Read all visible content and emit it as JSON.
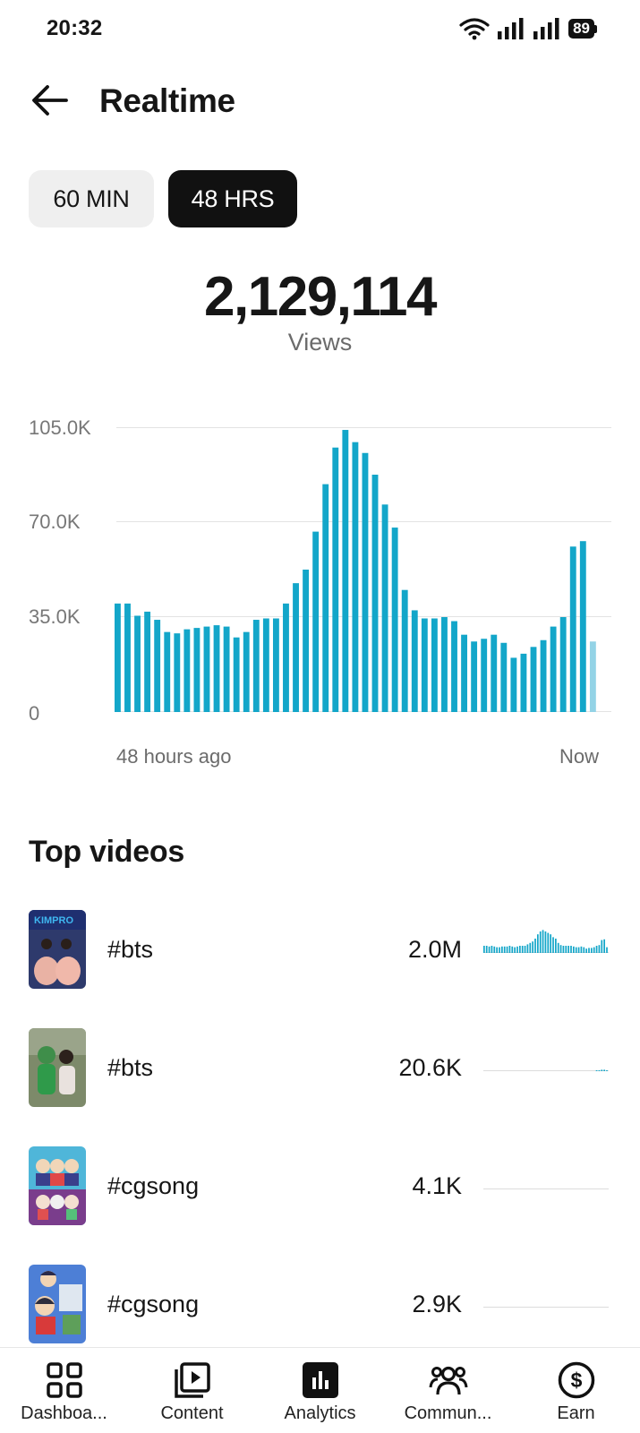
{
  "status_bar": {
    "time": "20:32",
    "battery": "89"
  },
  "header": {
    "title": "Realtime"
  },
  "range_tabs": [
    {
      "label": "60 MIN",
      "selected": false
    },
    {
      "label": "48 HRS",
      "selected": true
    }
  ],
  "total": {
    "value": "2,129,114",
    "label": "Views"
  },
  "chart_data": {
    "type": "bar",
    "x_start_label": "48 hours ago",
    "x_end_label": "Now",
    "yticks": [
      "105.0K",
      "70.0K",
      "35.0K",
      "0"
    ],
    "ylim": [
      0,
      105000
    ],
    "grid": true,
    "bar_color": "#13a6c9",
    "last_bar_color": "#93d3e6",
    "values": [
      40000,
      40000,
      35500,
      37000,
      34000,
      29500,
      29000,
      30500,
      31000,
      31500,
      32000,
      31500,
      27500,
      29500,
      34000,
      34500,
      34500,
      40000,
      47500,
      52500,
      66500,
      84000,
      97500,
      104000,
      99500,
      95500,
      87500,
      76500,
      68000,
      45000,
      37500,
      34500,
      34500,
      35000,
      33500,
      28500,
      26000,
      27000,
      28500,
      25500,
      20000,
      21500,
      24000,
      26500,
      31500,
      35000,
      61000,
      63000,
      26000
    ]
  },
  "top_videos": {
    "title": "Top videos",
    "items": [
      {
        "title": "#bts",
        "views": "2.0M",
        "trend": [
          0.1,
          0.1,
          0.09,
          0.1,
          0.09,
          0.08,
          0.08,
          0.09,
          0.09,
          0.09,
          0.1,
          0.09,
          0.08,
          0.09,
          0.1,
          0.1,
          0.1,
          0.12,
          0.14,
          0.16,
          0.2,
          0.26,
          0.3,
          0.32,
          0.3,
          0.28,
          0.26,
          0.22,
          0.2,
          0.14,
          0.11,
          0.1,
          0.1,
          0.1,
          0.1,
          0.09,
          0.08,
          0.08,
          0.09,
          0.08,
          0.06,
          0.07,
          0.07,
          0.08,
          0.1,
          0.11,
          0.18,
          0.19,
          0.08
        ]
      },
      {
        "title": "#bts",
        "views": "20.6K",
        "trend": [
          0,
          0,
          0,
          0,
          0,
          0,
          0,
          0,
          0,
          0,
          0,
          0,
          0,
          0,
          0,
          0,
          0,
          0,
          0,
          0,
          0,
          0,
          0,
          0,
          0,
          0,
          0,
          0,
          0,
          0,
          0,
          0,
          0,
          0,
          0,
          0,
          0,
          0,
          0,
          0,
          0,
          0,
          0,
          0,
          0.01,
          0.01,
          0.02,
          0.02,
          0.01
        ]
      },
      {
        "title": "#cgsong",
        "views": "4.1K",
        "trend": []
      },
      {
        "title": "#cgsong",
        "views": "2.9K",
        "trend": []
      }
    ]
  },
  "bottom_nav": [
    {
      "label": "Dashboa...",
      "icon": "dashboard-icon",
      "active": false
    },
    {
      "label": "Content",
      "icon": "content-icon",
      "active": false
    },
    {
      "label": "Analytics",
      "icon": "analytics-icon",
      "active": true
    },
    {
      "label": "Commun...",
      "icon": "community-icon",
      "active": false
    },
    {
      "label": "Earn",
      "icon": "earn-icon",
      "active": false
    }
  ]
}
